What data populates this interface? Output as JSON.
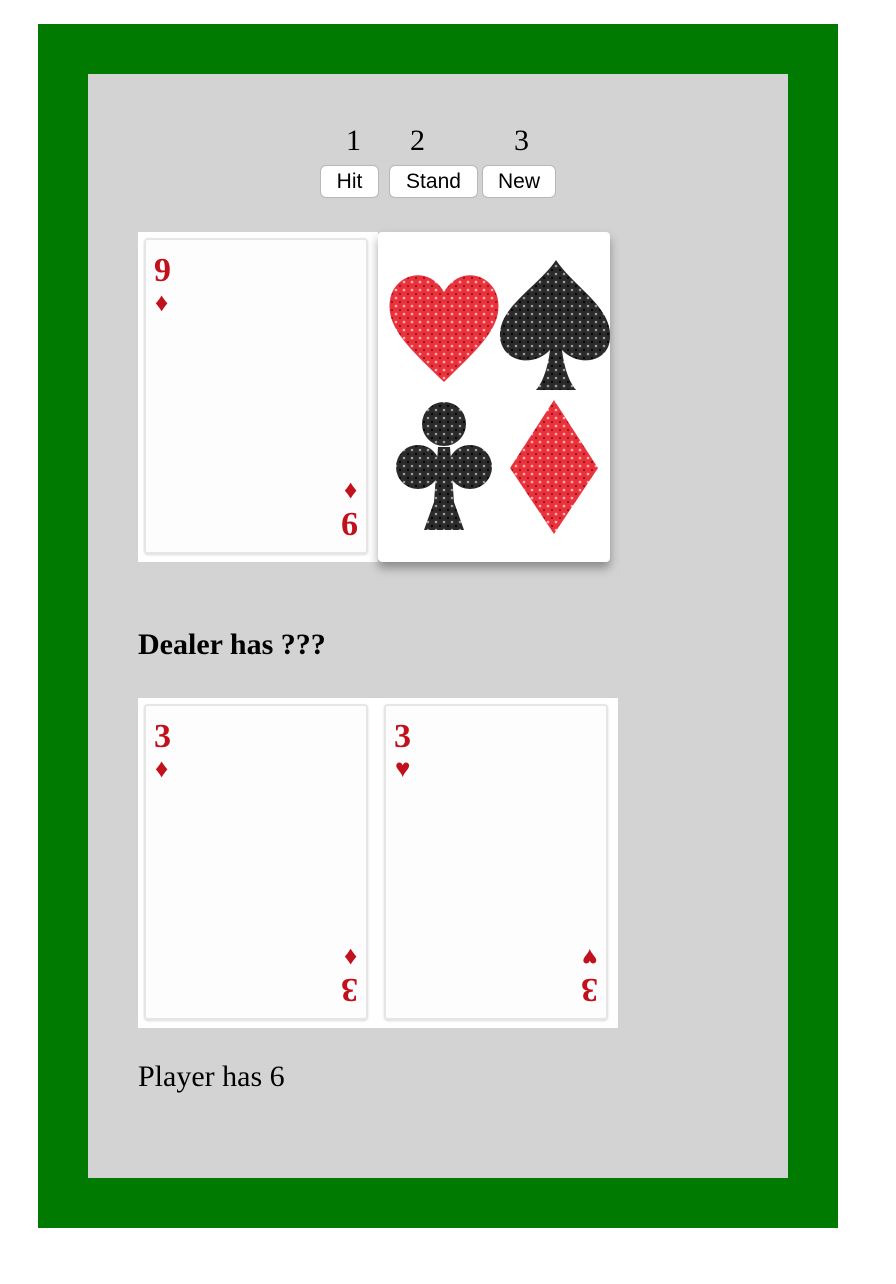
{
  "controls": {
    "hints": [
      "1",
      "2",
      "3"
    ],
    "hit_label": "Hit",
    "stand_label": "Stand",
    "new_label": "New"
  },
  "dealer": {
    "cards": [
      {
        "rank": "9",
        "suit": "♦",
        "suit_name": "diamonds",
        "face_up": true
      },
      {
        "face_up": false,
        "back_icons": [
          "heart-icon",
          "spade-icon",
          "club-icon",
          "diamond-icon"
        ]
      }
    ],
    "status": "Dealer has ???"
  },
  "player": {
    "cards": [
      {
        "rank": "3",
        "suit": "♦",
        "suit_name": "diamonds",
        "face_up": true
      },
      {
        "rank": "3",
        "suit": "♥",
        "suit_name": "hearts",
        "face_up": true
      }
    ],
    "status": "Player has 6"
  },
  "colors": {
    "table_green": "#007a00",
    "panel_gray": "#d3d3d3",
    "red_suit": "#c0111c",
    "black_suit": "#1a1a1a"
  }
}
